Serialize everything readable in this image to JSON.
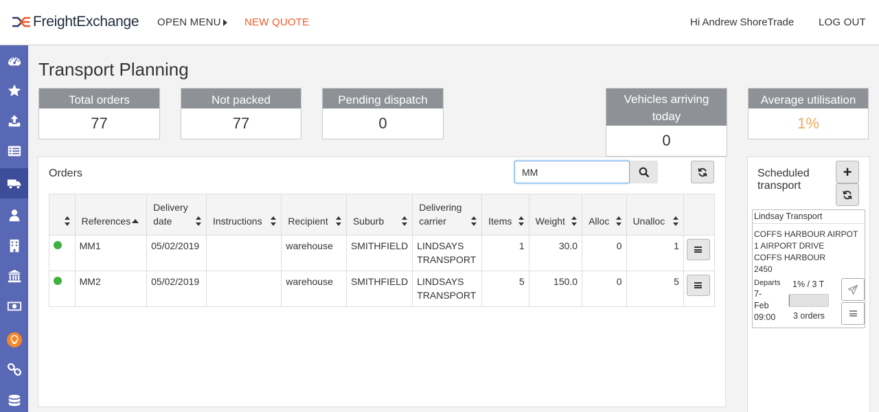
{
  "header": {
    "brand": "FreightExchange",
    "open_menu": "OPEN MENU",
    "new_quote": "NEW QUOTE",
    "greeting": "Hi Andrew ShoreTrade",
    "logout": "LOG OUT"
  },
  "sidebar": {
    "items": [
      {
        "icon": "dashboard-icon"
      },
      {
        "icon": "star-icon"
      },
      {
        "icon": "upload-icon"
      },
      {
        "icon": "list-icon"
      },
      {
        "icon": "truck-icon",
        "active": true
      },
      {
        "icon": "user-icon"
      },
      {
        "icon": "building-icon"
      },
      {
        "icon": "bank-icon"
      },
      {
        "icon": "money-icon"
      },
      {
        "icon": "lightbulb-icon"
      },
      {
        "icon": "link-icon"
      },
      {
        "icon": "database-icon"
      }
    ]
  },
  "page": {
    "title": "Transport Planning"
  },
  "stats": {
    "total_orders": {
      "label": "Total orders",
      "value": "77"
    },
    "not_packed": {
      "label": "Not packed",
      "value": "77"
    },
    "pending_dispatch": {
      "label": "Pending dispatch",
      "value": "0"
    },
    "vehicles_arriving": {
      "label": "Vehicles arriving today",
      "value": "0"
    },
    "average_utilisation": {
      "label": "Average utilisation",
      "value": "1%"
    }
  },
  "orders": {
    "title": "Orders",
    "search_value": "MM",
    "columns": [
      "",
      "References",
      "Delivery date",
      "Instructions",
      "Recipient",
      "Suburb",
      "Delivering carrier",
      "Items",
      "Weight",
      "Alloc",
      "Unalloc",
      ""
    ],
    "rows": [
      {
        "status": "green",
        "reference": "MM1",
        "delivery_date": "05/02/2019",
        "instructions": "",
        "recipient": "warehouse",
        "suburb": "SMITHFIELD",
        "carrier": "LINDSAYS TRANSPORT",
        "items": "1",
        "weight": "30.0",
        "alloc": "0",
        "unalloc": "1"
      },
      {
        "status": "green",
        "reference": "MM2",
        "delivery_date": "05/02/2019",
        "instructions": "",
        "recipient": "warehouse",
        "suburb": "SMITHFIELD",
        "carrier": "LINDSAYS TRANSPORT",
        "items": "5",
        "weight": "150.0",
        "alloc": "0",
        "unalloc": "5"
      }
    ]
  },
  "scheduled": {
    "title": "Scheduled transport",
    "card": {
      "carrier": "Lindsay Transport",
      "address_line1": "COFFS HARBOUR AIRPOT",
      "address_line2": "1 AIRPORT DRIVE",
      "address_line3": "COFFS HARBOUR",
      "address_line4": "2450",
      "departs_label": "Departs",
      "departs_day": "7-",
      "departs_month": "Feb",
      "departs_time": "09:00",
      "utilisation": "1% / 3 T",
      "utilisation_fraction": 0.01,
      "orders": "3 orders"
    }
  },
  "colors": {
    "sidebar": "#5968b4",
    "accent_orange": "#f05a28",
    "status_green": "#3fb040",
    "utilisation_orange": "#f0a95a"
  }
}
